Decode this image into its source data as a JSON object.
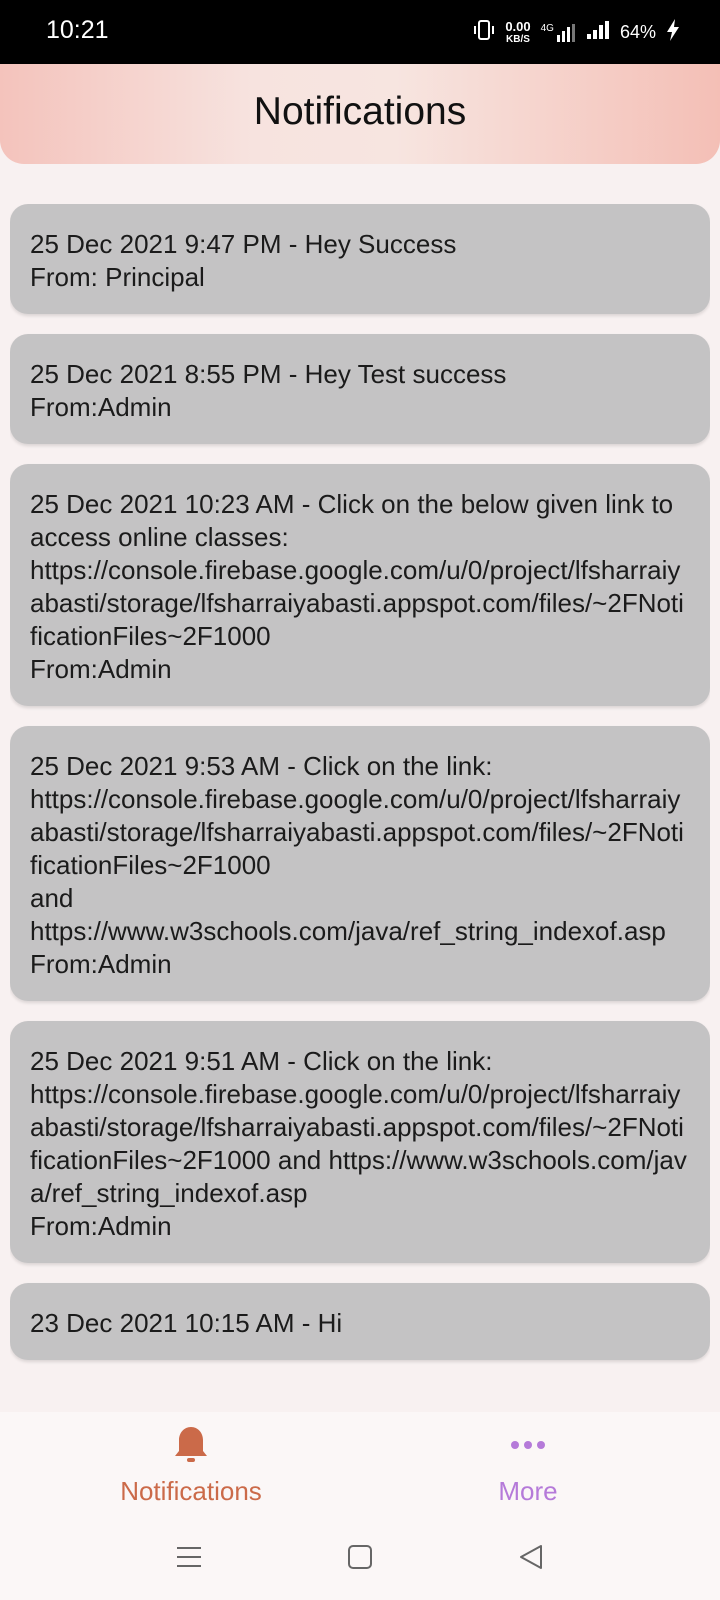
{
  "status_bar": {
    "time": "10:21",
    "net_speed_value": "0.00",
    "net_speed_unit": "KB/S",
    "network_type": "4G",
    "battery": "64%"
  },
  "header": {
    "title": "Notifications"
  },
  "notifications": [
    {
      "message": "25 Dec 2021 9:47 PM - Hey Success",
      "from": "From: Principal"
    },
    {
      "message": "25 Dec 2021 8:55 PM - Hey Test success",
      "from": "From:Admin"
    },
    {
      "message": "25 Dec 2021 10:23 AM - Click on the below given link to access online classes:\nhttps://console.firebase.google.com/u/0/project/lfsharraiyabasti/storage/lfsharraiyabasti.appspot.com/files/~2FNotificationFiles~2F1000",
      "from": "From:Admin"
    },
    {
      "message": "25 Dec 2021 9:53 AM - Click on the link:\nhttps://console.firebase.google.com/u/0/project/lfsharraiyabasti/storage/lfsharraiyabasti.appspot.com/files/~2FNotificationFiles~2F1000\nand\nhttps://www.w3schools.com/java/ref_string_indexof.asp",
      "from": "From:Admin"
    },
    {
      "message": "25 Dec 2021 9:51 AM - Click on the link:\nhttps://console.firebase.google.com/u/0/project/lfsharraiyabasti/storage/lfsharraiyabasti.appspot.com/files/~2FNotificationFiles~2F1000 and https://www.w3schools.com/java/ref_string_indexof.asp",
      "from": "From:Admin"
    },
    {
      "message": "23 Dec 2021 10:15 AM - Hi",
      "from": ""
    }
  ],
  "bottom_nav": {
    "notifications_label": "Notifications",
    "more_label": "More",
    "notifications_color": "#cb6a49",
    "more_color": "#b57ad9"
  }
}
